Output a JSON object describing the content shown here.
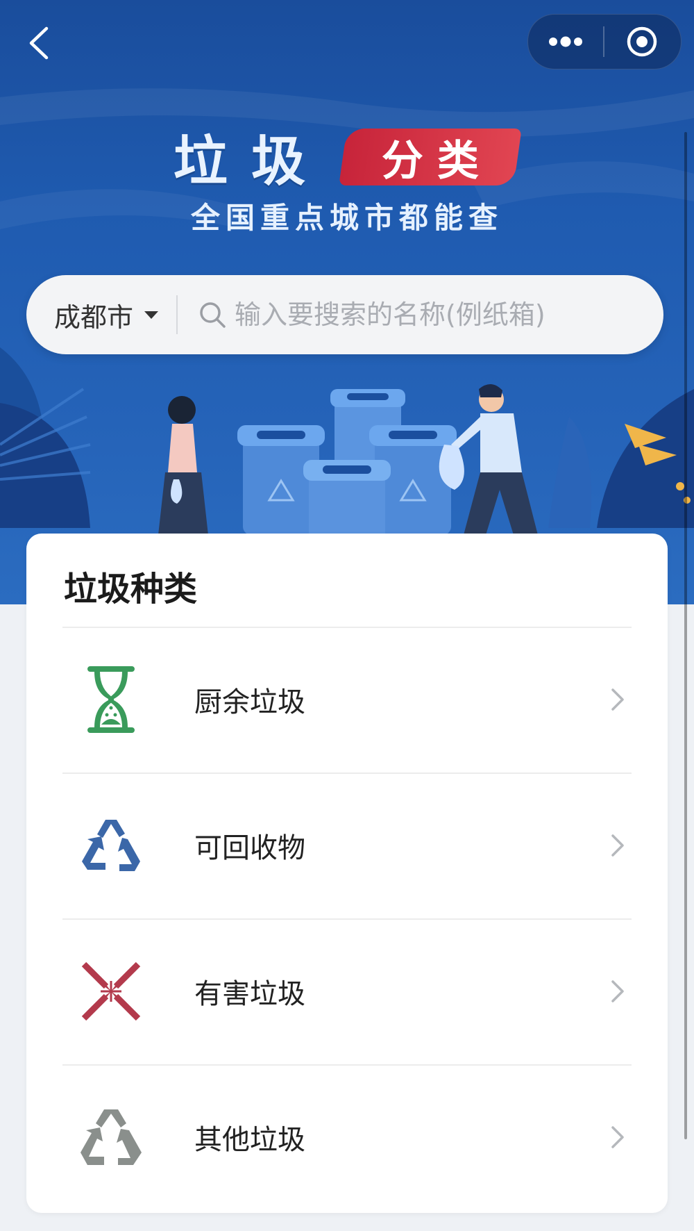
{
  "nav": {
    "back_icon": "chevron-left-icon",
    "more_icon": "more-dots-icon",
    "close_icon": "target-circle-icon"
  },
  "banner": {
    "title": "垃圾",
    "badge": "分类",
    "subtitle": "全国重点城市都能查"
  },
  "search": {
    "city": "成都市",
    "placeholder": "输入要搜索的名称(例纸箱)"
  },
  "categories": {
    "title": "垃圾种类",
    "items": [
      {
        "label": "厨余垃圾",
        "icon": "hourglass-icon",
        "color": "#3a9b5b"
      },
      {
        "label": "可回收物",
        "icon": "recycle-icon",
        "color": "#3b67a8"
      },
      {
        "label": "有害垃圾",
        "icon": "hazard-cross-icon",
        "color": "#b33a4c"
      },
      {
        "label": "其他垃圾",
        "icon": "other-recycle-icon",
        "color": "#8a8f8c"
      }
    ]
  },
  "colors": {
    "banner_blue": "#1f5bb0",
    "badge_red": "#d7323f"
  }
}
